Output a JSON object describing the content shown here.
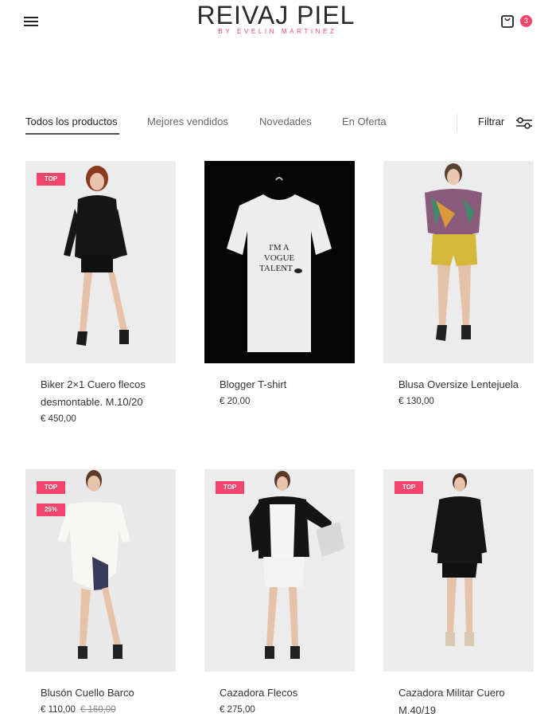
{
  "header": {
    "logo_main": "REIVAJ PIEL",
    "logo_sub": "BY EVELIN MARTINEZ",
    "cart_count": "3"
  },
  "tabs": [
    {
      "label": "Todos los productos"
    },
    {
      "label": "Mejores vendidos"
    },
    {
      "label": "Novedades"
    },
    {
      "label": "En Oferta"
    }
  ],
  "filter": {
    "label": "Filtrar"
  },
  "products": [
    {
      "name": "Biker 2×1 Cuero flecos desmontable. M.10/20",
      "price": "€ 450,00",
      "badges": [
        "TOP"
      ]
    },
    {
      "name": "Blogger T-shirt",
      "price": "€ 20,00",
      "badges": [],
      "shirt_text": "I'M A VOGUE TALENT"
    },
    {
      "name": "Blusa Oversize Lentejuela",
      "price": "€ 130,00",
      "badges": []
    },
    {
      "name": "Blusón Cuello Barco",
      "price": "€ 110,00",
      "old_price": "€ 160,00",
      "badges": [
        "TOP",
        "25%"
      ]
    },
    {
      "name": "Cazadora Flecos",
      "price": "€ 275,00",
      "badges": [
        "TOP"
      ]
    },
    {
      "name": "Cazadora Militar Cuero M.40/19",
      "price": "",
      "badges": [
        "TOP"
      ]
    }
  ],
  "colors": {
    "accent": "#f0466c",
    "text": "#222222"
  }
}
